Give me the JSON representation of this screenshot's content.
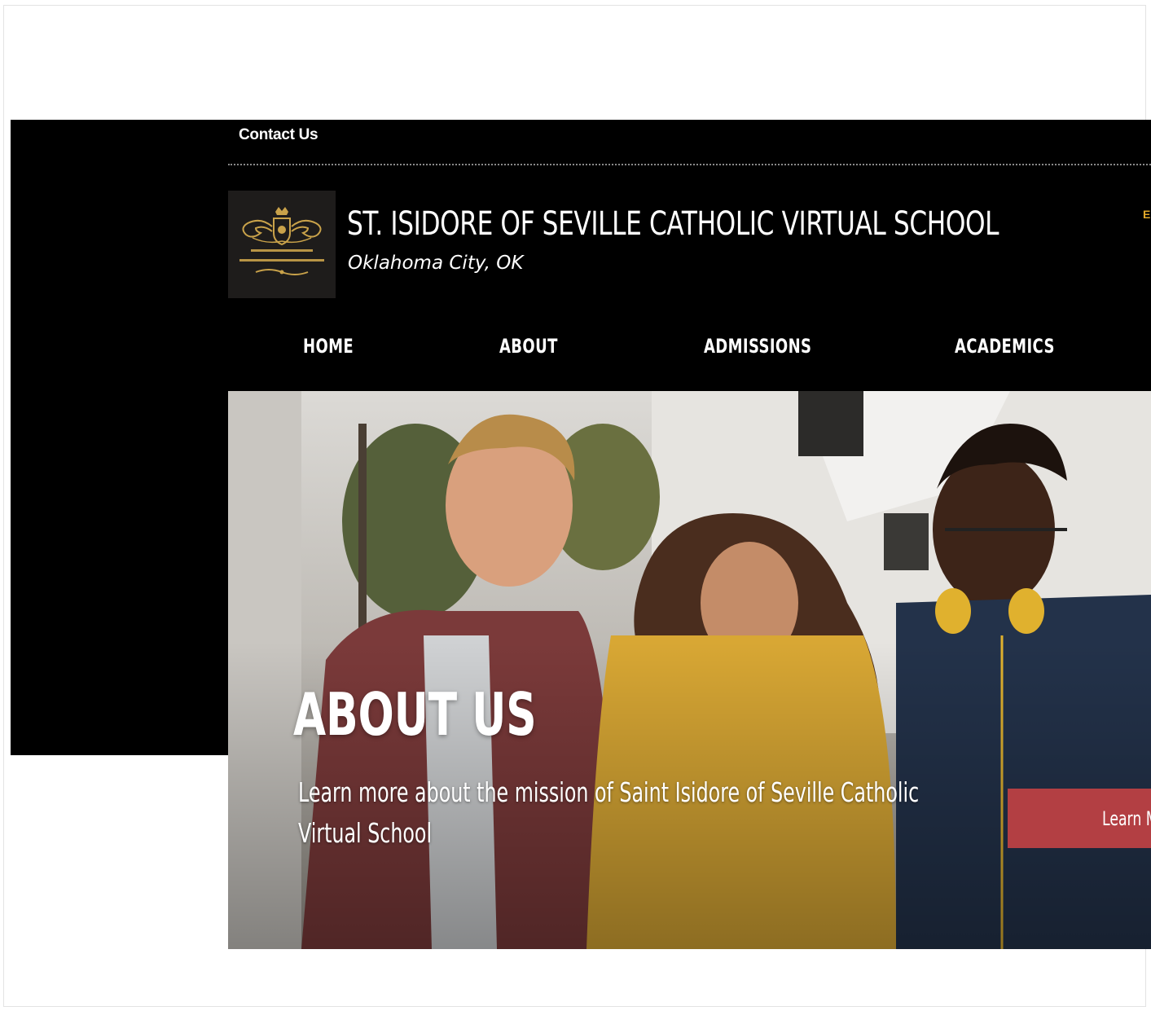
{
  "topbar": {
    "contact_label": "Contact Us"
  },
  "header": {
    "logo_text": "ST. ISIDORE OF SEVILLE CATHOLIC VIRTUAL SCHOOL",
    "school_name": "ST. ISIDORE OF SEVILLE CATHOLIC VIRTUAL SCHOOL",
    "location": "Oklahoma City, OK",
    "cutoff_letter": "E"
  },
  "nav": {
    "items": [
      {
        "label": "HOME"
      },
      {
        "label": "ABOUT"
      },
      {
        "label": "ADMISSIONS"
      },
      {
        "label": "ACADEMICS"
      }
    ]
  },
  "hero": {
    "title": "ABOUT US",
    "subtitle": "Learn more about the mission of Saint Isidore of Seville Catholic Virtual School",
    "button_label": "Learn M",
    "image_icon": "students-photo"
  },
  "colors": {
    "header_bg": "#000000",
    "accent_button": "#b33f43",
    "gold": "#c9a24a",
    "text": "#ffffff"
  }
}
